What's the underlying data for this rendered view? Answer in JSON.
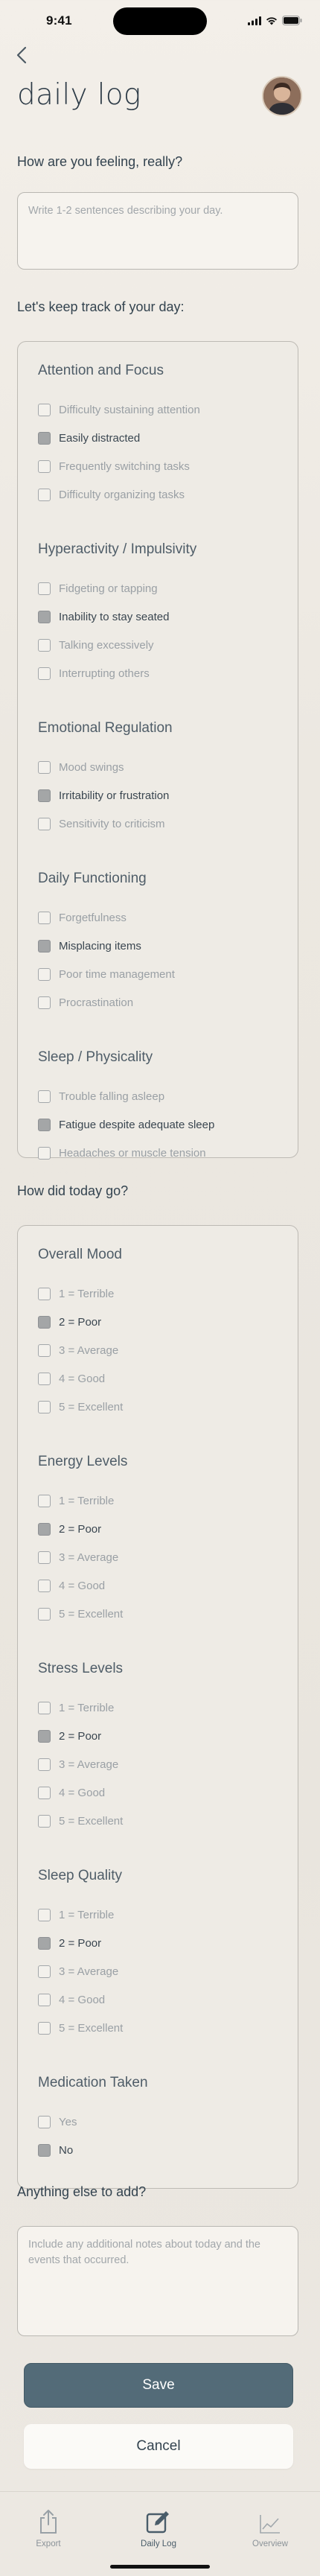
{
  "status": {
    "time": "9:41"
  },
  "header": {
    "title": "daily log"
  },
  "feeling": {
    "question": "How are you feeling, really?",
    "placeholder": "Write 1-2 sentences describing your day."
  },
  "track": {
    "heading": "Let's keep track of your day:",
    "groups": [
      {
        "title": "Attention and Focus",
        "options": [
          {
            "label": "Difficulty sustaining attention",
            "checked": false
          },
          {
            "label": "Easily distracted",
            "checked": true
          },
          {
            "label": "Frequently switching tasks",
            "checked": false
          },
          {
            "label": "Difficulty organizing tasks",
            "checked": false
          }
        ]
      },
      {
        "title": "Hyperactivity / Impulsivity",
        "options": [
          {
            "label": "Fidgeting or tapping",
            "checked": false
          },
          {
            "label": "Inability to stay seated",
            "checked": true
          },
          {
            "label": "Talking excessively",
            "checked": false
          },
          {
            "label": "Interrupting others",
            "checked": false
          }
        ]
      },
      {
        "title": "Emotional Regulation",
        "options": [
          {
            "label": "Mood swings",
            "checked": false
          },
          {
            "label": "Irritability or frustration",
            "checked": true
          },
          {
            "label": "Sensitivity to criticism",
            "checked": false
          }
        ]
      },
      {
        "title": "Daily Functioning",
        "options": [
          {
            "label": "Forgetfulness",
            "checked": false
          },
          {
            "label": "Misplacing items",
            "checked": true
          },
          {
            "label": "Poor time management",
            "checked": false
          },
          {
            "label": "Procrastination",
            "checked": false
          }
        ]
      },
      {
        "title": "Sleep / Physicality",
        "options": [
          {
            "label": "Trouble falling asleep",
            "checked": false
          },
          {
            "label": "Fatigue despite adequate sleep",
            "checked": true
          },
          {
            "label": "Headaches or muscle tension",
            "checked": false
          }
        ]
      }
    ]
  },
  "today": {
    "heading": "How did today go?",
    "groups": [
      {
        "title": "Overall Mood",
        "options": [
          {
            "label": "1 = Terrible",
            "checked": false
          },
          {
            "label": "2 = Poor",
            "checked": true
          },
          {
            "label": "3 = Average",
            "checked": false
          },
          {
            "label": "4 = Good",
            "checked": false
          },
          {
            "label": "5 = Excellent",
            "checked": false
          }
        ]
      },
      {
        "title": "Energy Levels",
        "options": [
          {
            "label": "1 = Terrible",
            "checked": false
          },
          {
            "label": "2 = Poor",
            "checked": true
          },
          {
            "label": "3 = Average",
            "checked": false
          },
          {
            "label": "4 = Good",
            "checked": false
          },
          {
            "label": "5 = Excellent",
            "checked": false
          }
        ]
      },
      {
        "title": "Stress Levels",
        "options": [
          {
            "label": "1 = Terrible",
            "checked": false
          },
          {
            "label": "2 = Poor",
            "checked": true
          },
          {
            "label": "3 = Average",
            "checked": false
          },
          {
            "label": "4 = Good",
            "checked": false
          },
          {
            "label": "5 = Excellent",
            "checked": false
          }
        ]
      },
      {
        "title": "Sleep Quality",
        "options": [
          {
            "label": "1 = Terrible",
            "checked": false
          },
          {
            "label": "2 = Poor",
            "checked": true
          },
          {
            "label": "3 = Average",
            "checked": false
          },
          {
            "label": "4 = Good",
            "checked": false
          },
          {
            "label": "5 = Excellent",
            "checked": false
          }
        ]
      },
      {
        "title": "Medication Taken",
        "options": [
          {
            "label": "Yes",
            "checked": false
          },
          {
            "label": "No",
            "checked": true
          }
        ]
      }
    ]
  },
  "notes": {
    "question": "Anything else to add?",
    "placeholder": "Include any additional notes about today and the events that occurred."
  },
  "actions": {
    "save": "Save",
    "cancel": "Cancel"
  },
  "tabs": [
    {
      "label": "Export",
      "icon": "share-icon"
    },
    {
      "label": "Daily Log",
      "icon": "edit-icon",
      "active": true
    },
    {
      "label": "Overview",
      "icon": "chart-icon"
    }
  ],
  "colors": {
    "primary": "#536b78",
    "checked": "#a4a6a7",
    "background": "#ece8e2"
  }
}
